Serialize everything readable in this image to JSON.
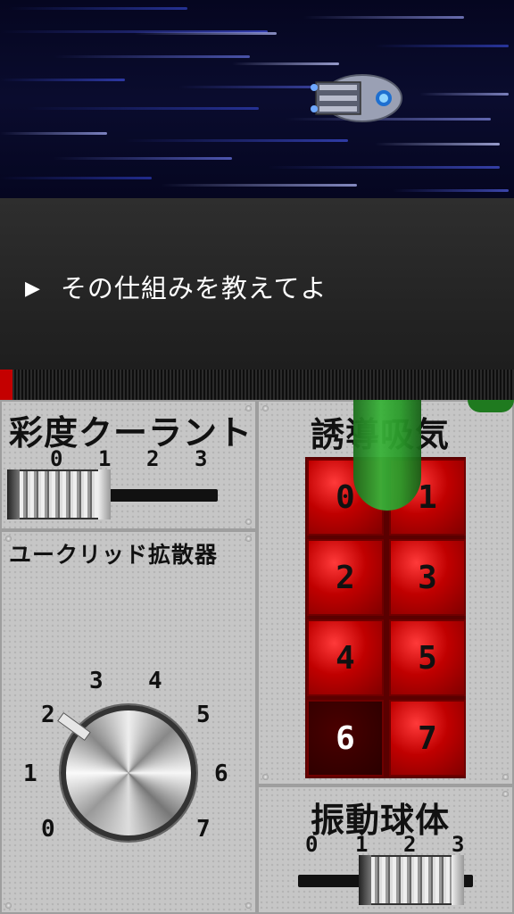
{
  "dialog": {
    "prompt_marker": "▶",
    "text": "その仕組みを教えてよ"
  },
  "progress": {
    "fraction": 0.025,
    "color": "#c40000"
  },
  "saturation_panel": {
    "title": "彩度クーラント",
    "ticks": [
      "0",
      "1",
      "2",
      "3"
    ],
    "value": 0
  },
  "euclid_panel": {
    "title": "ユークリッド拡散器",
    "dial_labels": [
      "0",
      "1",
      "2",
      "3",
      "4",
      "5",
      "6",
      "7"
    ],
    "value": 2
  },
  "induction_panel": {
    "title": "誘導吸気",
    "keys": [
      "0",
      "1",
      "2",
      "3",
      "4",
      "5",
      "6",
      "7"
    ],
    "active_key": "6"
  },
  "vibration_panel": {
    "title": "振動球体",
    "ticks": [
      "0",
      "1",
      "2",
      "3"
    ],
    "value": 3
  },
  "icons": {
    "ship": "spaceship-icon",
    "screw": "screw-icon",
    "play": "play-triangle-icon"
  },
  "colors": {
    "key_red": "#c00000",
    "tube_green": "#2a9a2a",
    "dialog_bg": "#262626"
  }
}
